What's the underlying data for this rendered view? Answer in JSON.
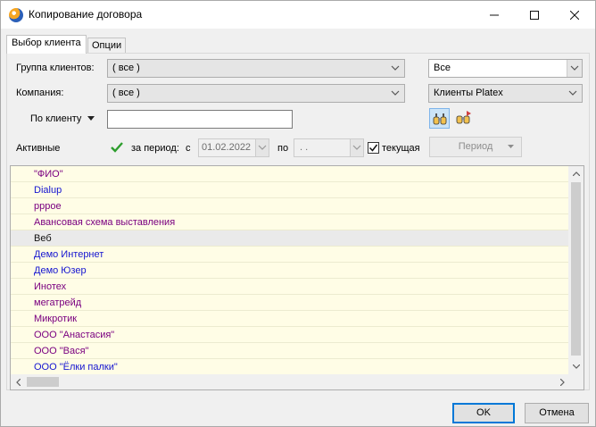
{
  "window": {
    "title": "Копирование договора"
  },
  "tabs": [
    {
      "label": "Выбор клиента"
    },
    {
      "label": "Опции"
    }
  ],
  "filters": {
    "group_label": "Группа клиентов:",
    "group_value": "( все )",
    "company_label": "Компания:",
    "company_value": "( все )",
    "by_client_label": "По клиенту",
    "by_client_value": "",
    "right_combo_1": "Все",
    "right_combo_2": "Клиенты Platex"
  },
  "period": {
    "active_label": "Активные",
    "for_period_label": "за период:",
    "from_label": "с",
    "from_value": "01.02.2022",
    "to_label": "по",
    "to_value": " .  .",
    "current_label": "текущая",
    "current_checked": true,
    "period_button": "Период"
  },
  "clients": [
    {
      "name": "\"ФИО\"",
      "color": "purple"
    },
    {
      "name": "Dialup",
      "color": "blue"
    },
    {
      "name": "рррое",
      "color": "purple"
    },
    {
      "name": "Авансовая схема выставления",
      "color": "purple"
    },
    {
      "name": "Веб",
      "color": "selected"
    },
    {
      "name": "Демо Интернет",
      "color": "blue"
    },
    {
      "name": "Демо Юзер",
      "color": "blue"
    },
    {
      "name": "Инотех",
      "color": "purple"
    },
    {
      "name": "мегатрейд",
      "color": "purple"
    },
    {
      "name": "Микротик",
      "color": "purple"
    },
    {
      "name": "ООО \"Анастасия\"",
      "color": "purple"
    },
    {
      "name": "ООО \"Вася\"",
      "color": "purple"
    },
    {
      "name": "ООО \"Ёлки палки\"",
      "color": "blue"
    }
  ],
  "footer": {
    "ok": "OK",
    "cancel": "Отмена"
  }
}
